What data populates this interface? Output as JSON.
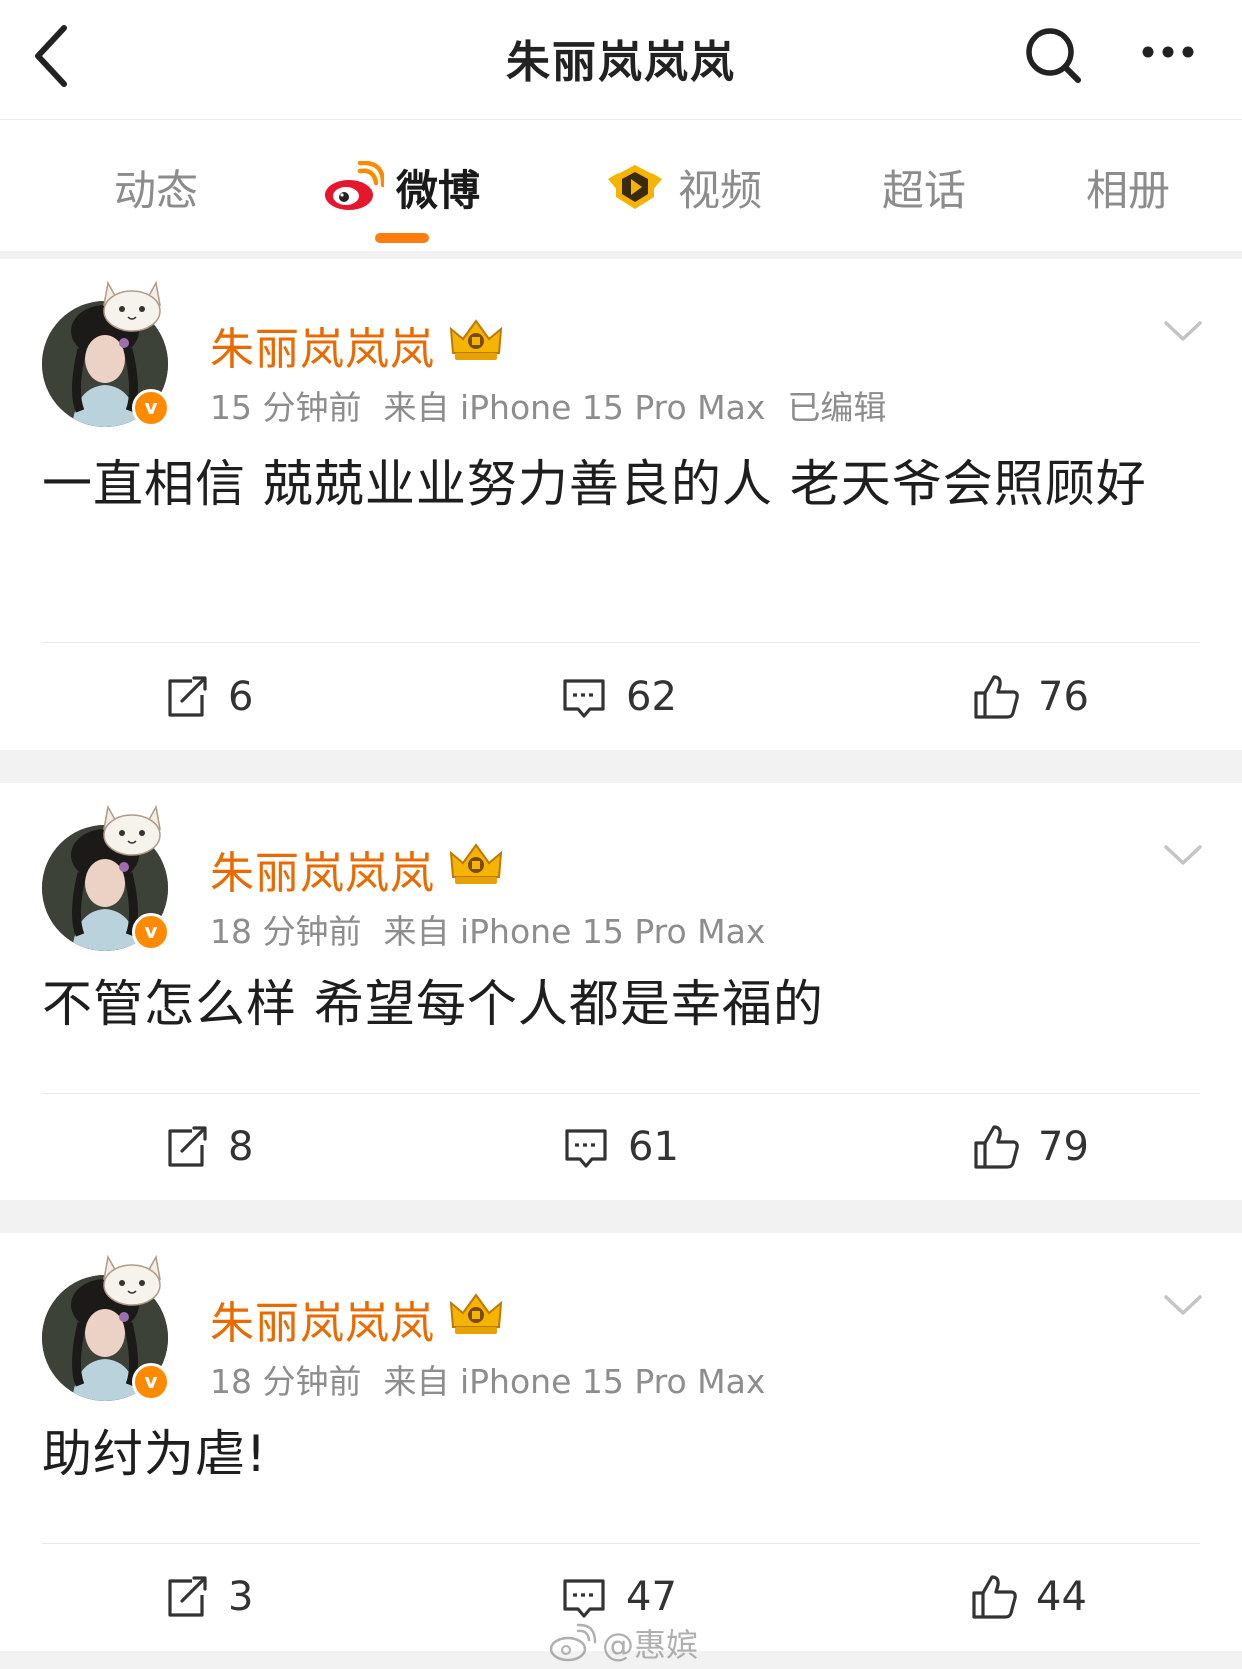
{
  "header": {
    "title": "朱丽岚岚岚"
  },
  "tabs": [
    {
      "label": "动态",
      "active": false
    },
    {
      "label": "微博",
      "active": true,
      "icon": "weibo-logo-icon"
    },
    {
      "label": "视频",
      "active": false,
      "icon": "video-play-icon"
    },
    {
      "label": "超话",
      "active": false
    },
    {
      "label": "相册",
      "active": false
    }
  ],
  "colors": {
    "accent": "#ff7d0f",
    "username": "#ea6a00",
    "meta": "#8d8d8d",
    "separator": "#f2f2f2"
  },
  "posts": [
    {
      "username": "朱丽岚岚岚",
      "time": "15 分钟前",
      "source": "来自 iPhone 15 Pro Max",
      "edited": "已编辑",
      "text": "一直相信 兢兢业业努力善良的人 老天爷会照顾好",
      "reposts": "6",
      "comments": "62",
      "likes": "76"
    },
    {
      "username": "朱丽岚岚岚",
      "time": "18 分钟前",
      "source": "来自 iPhone 15 Pro Max",
      "text": "不管怎么样 希望每个人都是幸福的",
      "reposts": "8",
      "comments": "61",
      "likes": "79"
    },
    {
      "username": "朱丽岚岚岚",
      "time": "18 分钟前",
      "source": "来自 iPhone 15 Pro Max",
      "text": "助纣为虐!",
      "reposts": "3",
      "comments": "47",
      "likes": "44"
    }
  ],
  "avatar_badge": "v",
  "watermark": "@惠嫔"
}
